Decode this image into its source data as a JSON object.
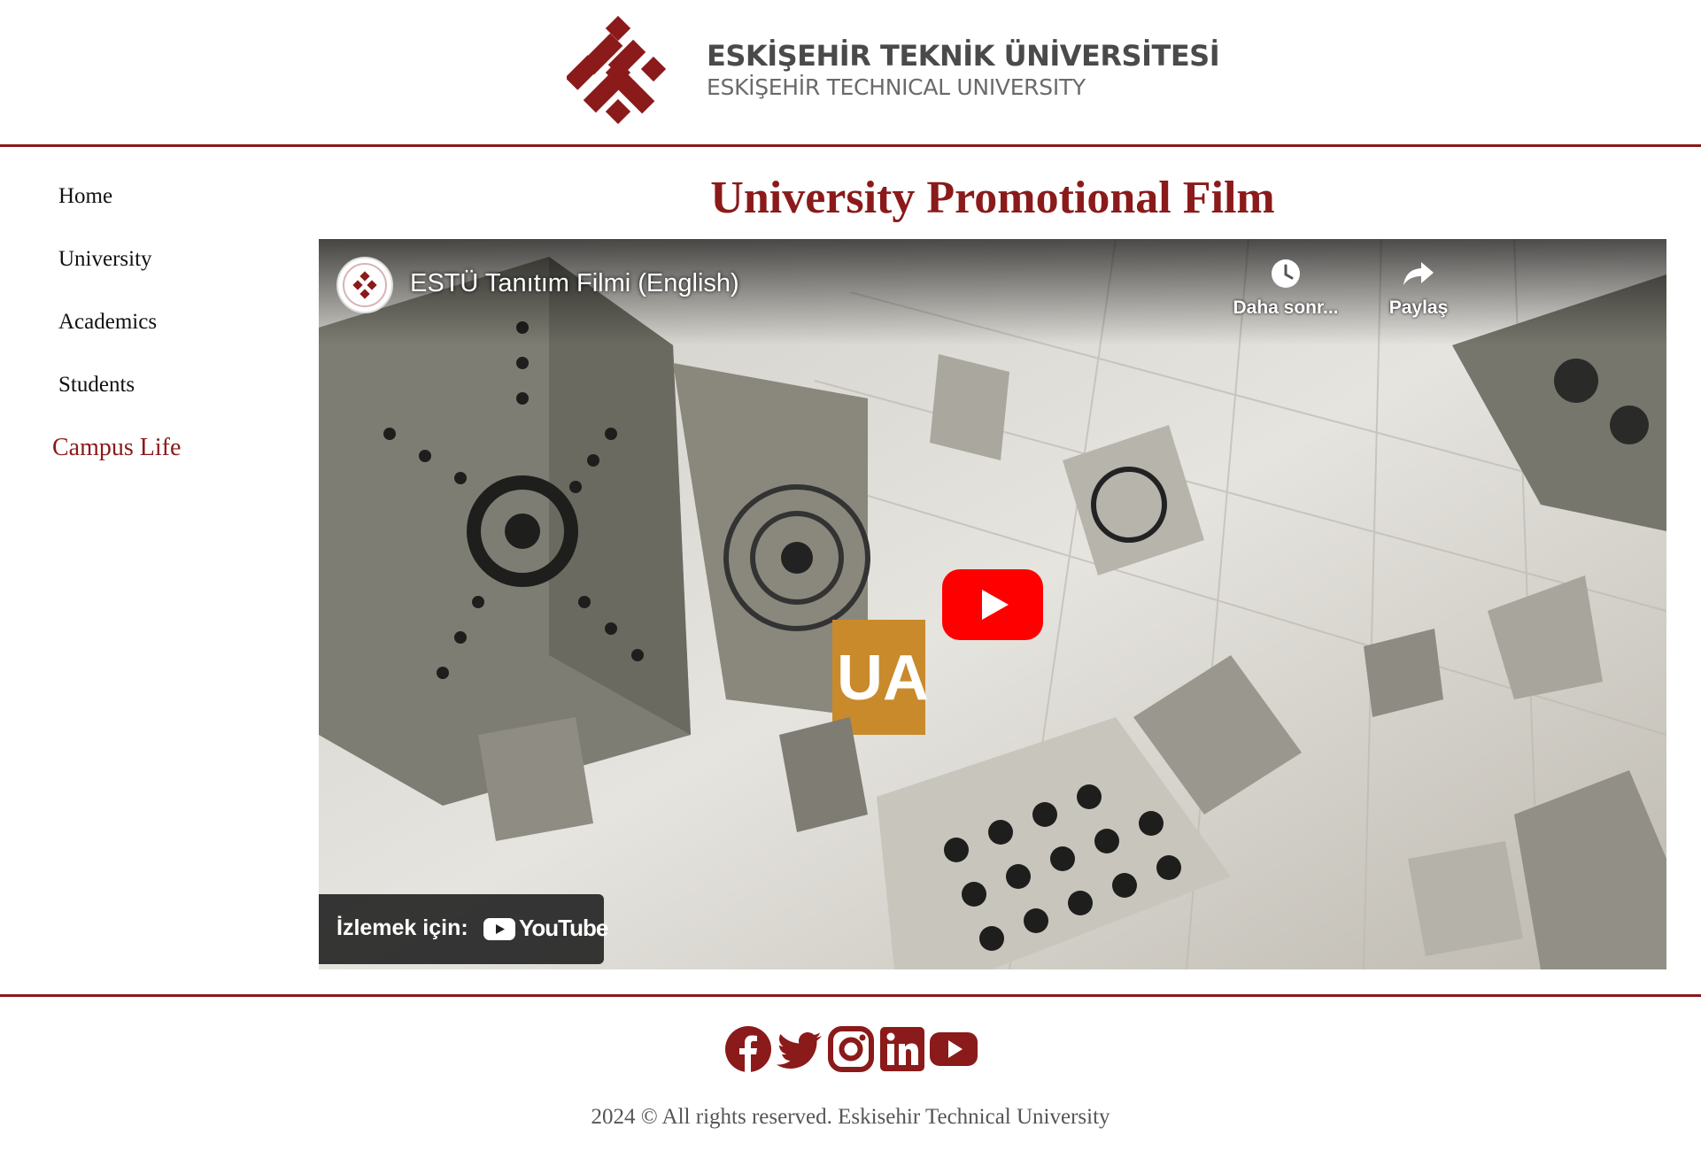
{
  "header": {
    "logo_line_1": "ESKİŞEHİR TEKNİK ÜNİVERSİTESİ",
    "logo_line_2": "ESKİŞEHİR TECHNICAL UNIVERSITY"
  },
  "sidebar": {
    "items": [
      {
        "label": "Home"
      },
      {
        "label": "University"
      },
      {
        "label": "Academics"
      },
      {
        "label": "Students"
      },
      {
        "label": "Campus Life",
        "active": true
      }
    ]
  },
  "main": {
    "title": "University Promotional Film",
    "video": {
      "title": "ESTÜ Tanıtım Filmi (English)",
      "watch_later_label": "Daha sonr...",
      "share_label": "Paylaş",
      "watch_on_label": "İzlemek için:",
      "youtube_word": "YouTube"
    }
  },
  "footer": {
    "social_icons": [
      "facebook-icon",
      "twitter-icon",
      "instagram-icon",
      "linkedin-icon",
      "youtube-icon"
    ],
    "copyright": "2024 © All rights reserved. Eskisehir Technical University"
  },
  "colors": {
    "brand": "#8b1a1a",
    "youtube_red": "#ff0000"
  }
}
